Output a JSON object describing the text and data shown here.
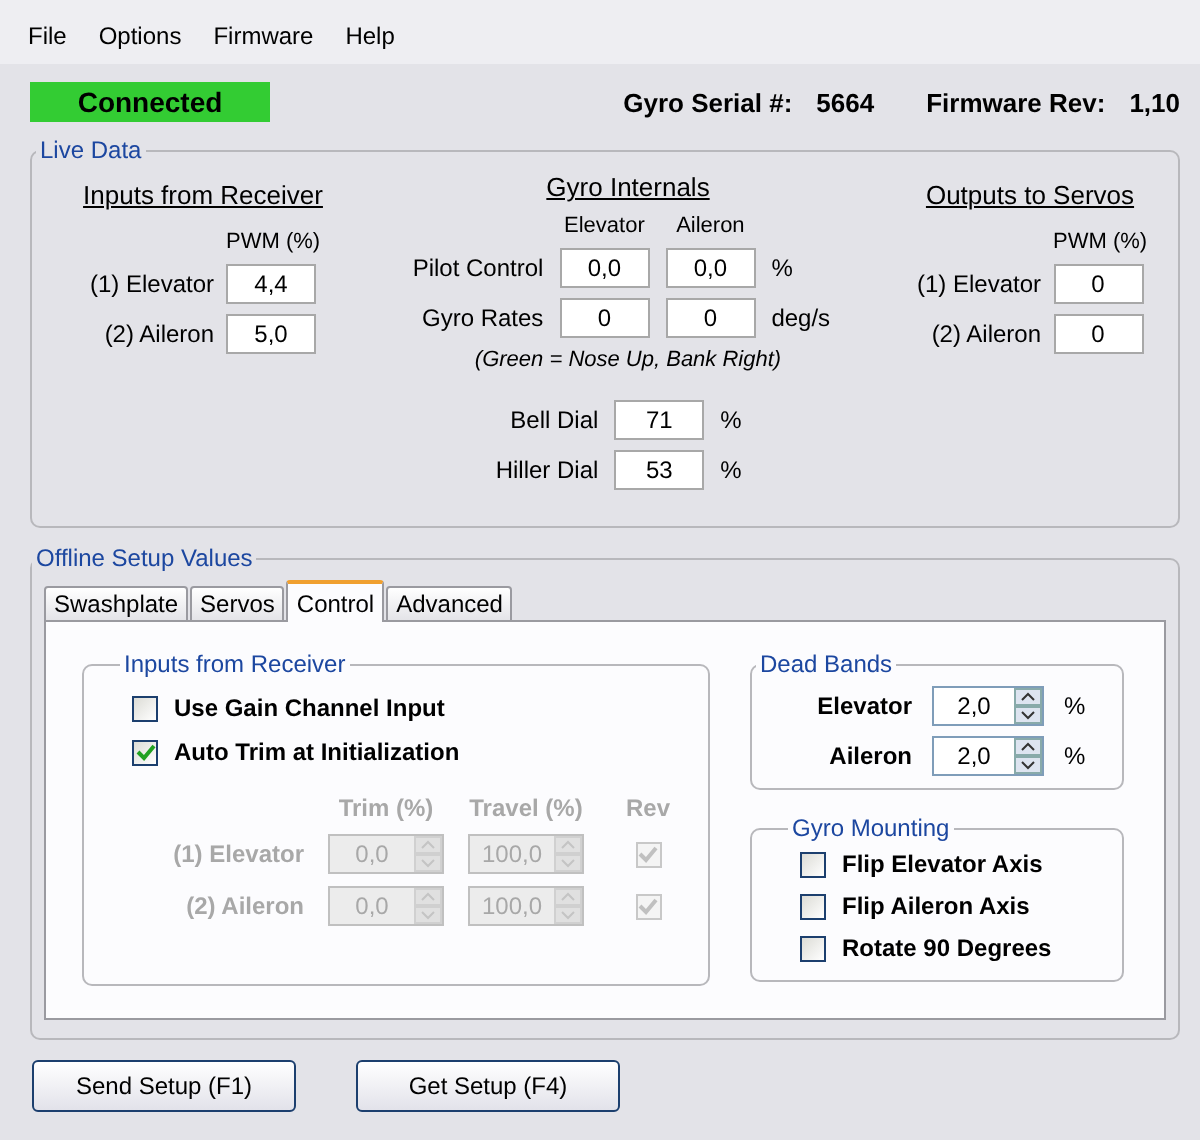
{
  "menu": [
    "File",
    "Options",
    "Firmware",
    "Help"
  ],
  "status": {
    "text": "Connected",
    "connected": true
  },
  "serial": {
    "label": "Gyro Serial #:",
    "value": "5664"
  },
  "firmware": {
    "label": "Firmware Rev:",
    "value": "1,10"
  },
  "live_data": {
    "title": "Live Data",
    "inputs": {
      "title": "Inputs from Receiver",
      "column": "PWM (%)",
      "rows": [
        {
          "label": "(1) Elevator",
          "value": "4,4"
        },
        {
          "label": "(2) Aileron",
          "value": "5,0"
        }
      ]
    },
    "internals": {
      "title": "Gyro Internals",
      "columns": [
        "Elevator",
        "Aileron"
      ],
      "rows": [
        {
          "label": "Pilot Control",
          "values": [
            "0,0",
            "0,0"
          ],
          "unit": "%"
        },
        {
          "label": "Gyro Rates",
          "values": [
            "0",
            "0"
          ],
          "unit": "deg/s"
        }
      ],
      "note": "(Green = Nose Up, Bank Right)",
      "dials": [
        {
          "label": "Bell Dial",
          "value": "71",
          "unit": "%"
        },
        {
          "label": "Hiller Dial",
          "value": "53",
          "unit": "%"
        }
      ]
    },
    "outputs": {
      "title": "Outputs to Servos",
      "column": "PWM (%)",
      "rows": [
        {
          "label": "(1) Elevator",
          "value": "0"
        },
        {
          "label": "(2) Aileron",
          "value": "0"
        }
      ]
    }
  },
  "offline": {
    "title": "Offline Setup Values",
    "tabs": [
      {
        "label": "Swashplate",
        "selected": false
      },
      {
        "label": "Servos",
        "selected": false
      },
      {
        "label": "Control",
        "selected": true
      },
      {
        "label": "Advanced",
        "selected": false
      }
    ],
    "inputs_group": {
      "title": "Inputs from Receiver",
      "options": [
        {
          "label": "Use Gain Channel Input",
          "checked": false
        },
        {
          "label": "Auto Trim at Initialization",
          "checked": true
        }
      ],
      "columns": [
        "Trim (%)",
        "Travel (%)",
        "Rev"
      ],
      "disabled": true,
      "rows": [
        {
          "label": "(1) Elevator",
          "trim": "0,0",
          "travel": "100,0",
          "rev": true
        },
        {
          "label": "(2) Aileron",
          "trim": "0,0",
          "travel": "100,0",
          "rev": true
        }
      ]
    },
    "dead_bands": {
      "title": "Dead Bands",
      "rows": [
        {
          "label": "Elevator",
          "value": "2,0",
          "unit": "%"
        },
        {
          "label": "Aileron",
          "value": "2,0",
          "unit": "%"
        }
      ]
    },
    "gyro_mounting": {
      "title": "Gyro Mounting",
      "options": [
        {
          "label": "Flip Elevator Axis",
          "checked": false
        },
        {
          "label": "Flip Aileron Axis",
          "checked": false
        },
        {
          "label": "Rotate 90 Degrees",
          "checked": false
        }
      ]
    }
  },
  "buttons": [
    "Send Setup (F1)",
    "Get Setup (F4)"
  ]
}
